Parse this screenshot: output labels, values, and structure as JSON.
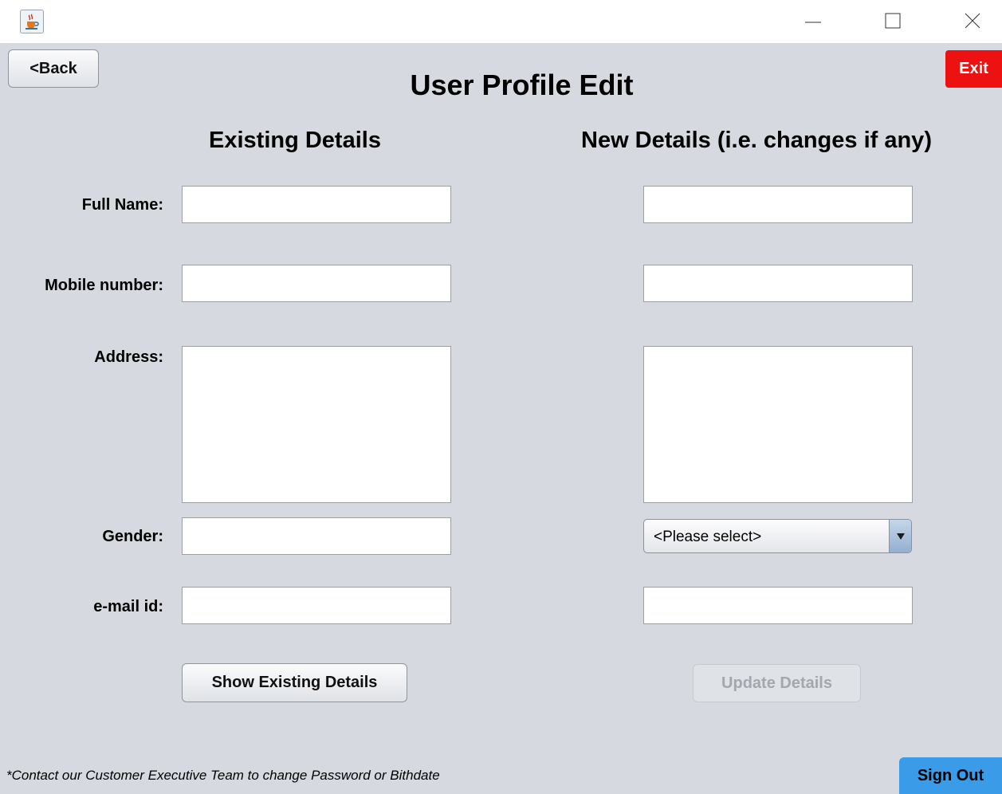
{
  "window": {
    "app_icon": "java-cup-icon",
    "controls": [
      "minimize-icon",
      "maximize-icon",
      "close-icon"
    ]
  },
  "header": {
    "back_label": "<Back",
    "exit_label": "Exit",
    "title": "User Profile Edit"
  },
  "columns": {
    "existing_heading": "Existing Details",
    "new_heading": "New Details (i.e. changes if any)"
  },
  "form": {
    "full_name_label": "Full Name:",
    "mobile_label": "Mobile number:",
    "address_label": "Address:",
    "gender_label": "Gender:",
    "email_label": "e-mail id:",
    "gender_select_value": "<Please select>",
    "existing": {
      "full_name": "",
      "mobile": "",
      "address": "",
      "gender": "",
      "email": ""
    },
    "new": {
      "full_name": "",
      "mobile": "",
      "address": "",
      "email": ""
    }
  },
  "actions": {
    "show_label": "Show Existing Details",
    "update_label": "Update Details",
    "signout_label": "Sign Out"
  },
  "footer": {
    "note": "*Contact our Customer Executive Team to change Password or Bithdate"
  },
  "colors": {
    "background": "#d6d9e0",
    "exit": "#ee1111",
    "signout": "#3a9be8"
  }
}
